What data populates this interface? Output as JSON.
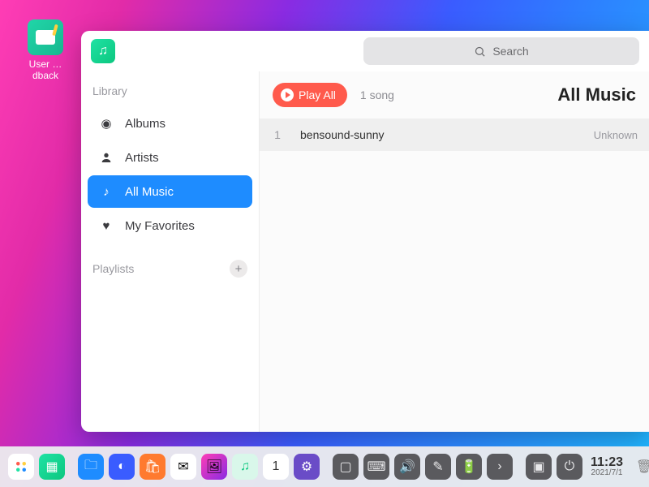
{
  "desktop": {
    "icon_label": "User …dback"
  },
  "search": {
    "placeholder": "Search"
  },
  "sidebar": {
    "library_header": "Library",
    "playlists_header": "Playlists",
    "items": [
      {
        "label": "Albums"
      },
      {
        "label": "Artists"
      },
      {
        "label": "All Music"
      },
      {
        "label": "My Favorites"
      }
    ]
  },
  "main": {
    "play_all_label": "Play All",
    "song_count": "1 song",
    "title": "All Music",
    "tracks": [
      {
        "index": "1",
        "name": "bensound-sunny",
        "artist": "Unknown"
      }
    ]
  },
  "taskbar": {
    "time": "11:23",
    "date": "2021/7/1"
  },
  "colors": {
    "accent": "#1e8cff",
    "play": "#ff5a4c"
  }
}
